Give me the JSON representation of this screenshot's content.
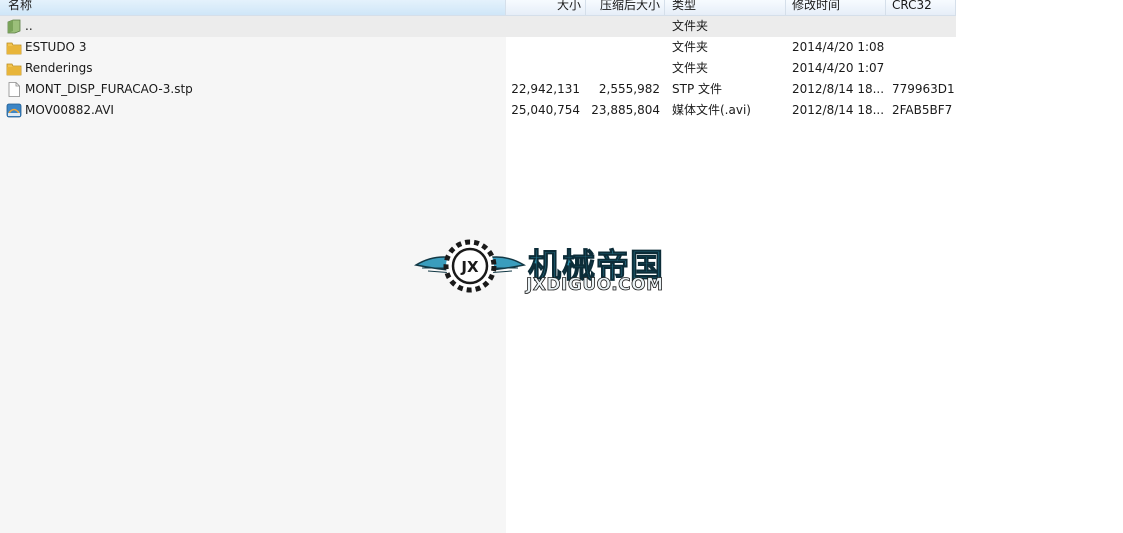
{
  "columns": {
    "name": "名称",
    "size": "大小",
    "packed": "压缩后大小",
    "type": "类型",
    "modified": "修改时间",
    "crc": "CRC32"
  },
  "files": [
    {
      "icon": "parent-folder-icon",
      "name": "..",
      "size": "",
      "packed": "",
      "type": "文件夹",
      "modified": "",
      "crc": ""
    },
    {
      "icon": "folder-icon",
      "name": "ESTUDO 3",
      "size": "",
      "packed": "",
      "type": "文件夹",
      "modified": "2014/4/20 1:08",
      "crc": ""
    },
    {
      "icon": "folder-icon",
      "name": "Renderings",
      "size": "",
      "packed": "",
      "type": "文件夹",
      "modified": "2014/4/20 1:07",
      "crc": ""
    },
    {
      "icon": "document-icon",
      "name": "MONT_DISP_FURACAO-3.stp",
      "size": "22,942,131",
      "packed": "2,555,982",
      "type": "STP 文件",
      "modified": "2012/8/14 18...",
      "crc": "779963D1"
    },
    {
      "icon": "video-file-icon",
      "name": "MOV00882.AVI",
      "size": "25,040,754",
      "packed": "23,885,804",
      "type": "媒体文件(.avi)",
      "modified": "2012/8/14 18...",
      "crc": "2FAB5BF7"
    }
  ],
  "watermark": {
    "chinese": "机械帝国",
    "english": "JXDIGUO.COM",
    "emblem_text": "JX"
  },
  "colors": {
    "folder": "#e8b53a",
    "selected_header": "#cfe6f8",
    "logo_blue": "#2e8da9"
  }
}
